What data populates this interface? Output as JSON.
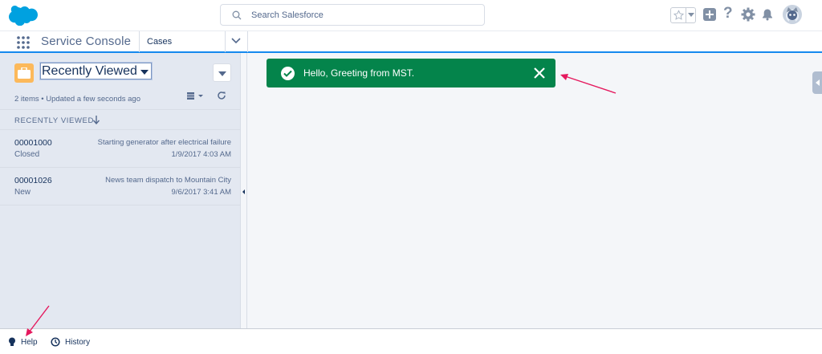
{
  "header": {
    "search_placeholder": "Search Salesforce"
  },
  "nav": {
    "app_name": "Service Console",
    "object_tab": "Cases"
  },
  "list_view": {
    "name": "Recently Viewed",
    "meta": "2 items • Updated a few seconds ago",
    "column_header": "RECENTLY VIEWED",
    "items": [
      {
        "case_number": "00001000",
        "status": "Closed",
        "subject": "Starting generator after electrical failure",
        "date": "1/9/2017 4:03 AM"
      },
      {
        "case_number": "00001026",
        "status": "New",
        "subject": "News team dispatch to Mountain City",
        "date": "9/6/2017 3:41 AM"
      }
    ]
  },
  "toast": {
    "message": "Hello, Greeting from MST.",
    "color": "#04844b"
  },
  "utility_bar": {
    "help_label": "Help",
    "history_label": "History"
  },
  "colors": {
    "brand": "#1589ee",
    "annotation_arrow": "#e5195e"
  }
}
